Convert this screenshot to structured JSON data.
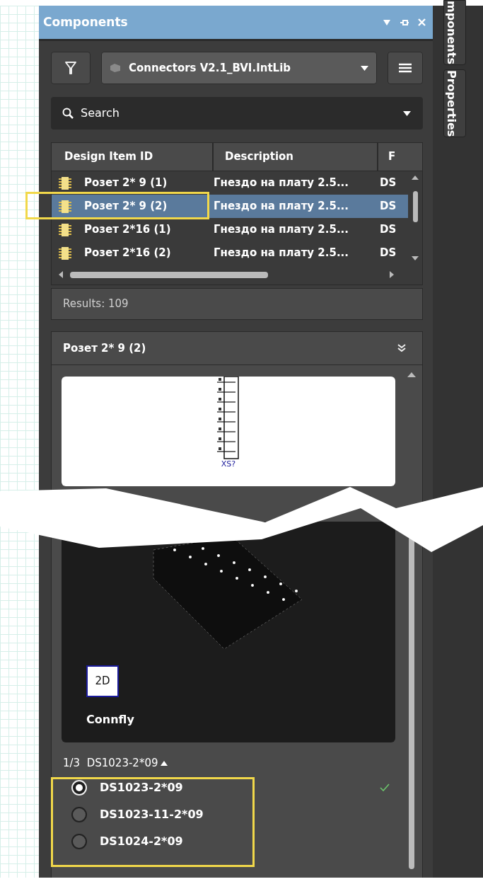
{
  "panel": {
    "title": "Components"
  },
  "library": {
    "value": "Connectors V2.1_BVI.IntLib"
  },
  "search": {
    "placeholder": "Search"
  },
  "table": {
    "columns": [
      "Design Item ID",
      "Description",
      "F"
    ],
    "rows": [
      {
        "cells": [
          "Розет 2* 9  (1)",
          "Гнездо на плату 2.5...",
          "DS"
        ],
        "selected": false
      },
      {
        "cells": [
          "Розет 2* 9  (2)",
          "Гнездо на плату 2.5...",
          "DS"
        ],
        "selected": true
      },
      {
        "cells": [
          "Розет 2*16  (1)",
          "Гнездо на плату 2.5...",
          "DS"
        ],
        "selected": false
      },
      {
        "cells": [
          "Розет 2*16  (2)",
          "Гнездо на плату 2.5...",
          "DS"
        ],
        "selected": false
      }
    ]
  },
  "results": "Results: 109",
  "details": {
    "title": "Розет 2* 9  (2)",
    "symbol_label": "XS?",
    "view_button": "2D",
    "manufacturer": "Connfly",
    "variant_header": "1/3  DS1023-2*09",
    "variants": [
      {
        "label": "DS1023-2*09",
        "selected": true,
        "current": true
      },
      {
        "label": "DS1023-11-2*09",
        "selected": false,
        "current": false
      },
      {
        "label": "DS1024-2*09",
        "selected": false,
        "current": false
      }
    ]
  },
  "side_tabs": [
    "mponents",
    "Properties"
  ]
}
